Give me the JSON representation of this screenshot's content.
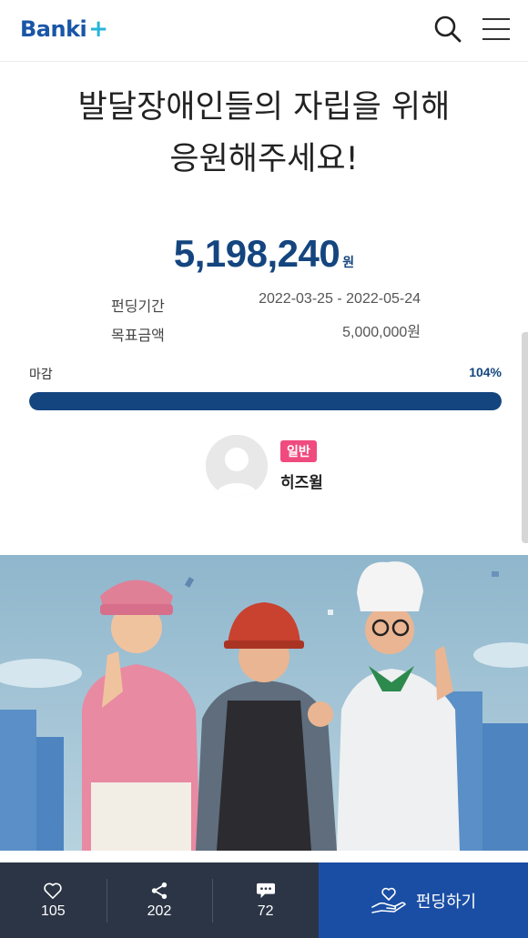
{
  "header": {
    "logo_text": "Banki",
    "logo_plus": "+",
    "search_icon": "search-icon",
    "menu_icon": "hamburger-menu-icon"
  },
  "project": {
    "title_line1": "발달장애인들의 자립을 위해",
    "title_line2": "응원해주세요!",
    "amount": "5,198,240",
    "amount_unit": "원",
    "period_label": "펀딩기간",
    "period_value": "2022-03-25 - 2022-05-24",
    "goal_label": "목표금액",
    "goal_value": "5,000,000원",
    "status_label": "마감",
    "percent_text": "104%",
    "progress_fraction": 1.0
  },
  "author": {
    "badge": "일반",
    "name": "히즈윌"
  },
  "bottom_bar": {
    "likes": "105",
    "shares": "202",
    "comments": "72",
    "fund_label": "펀딩하기"
  },
  "colors": {
    "brand": "#1a56a8",
    "accent_plus": "#27b5d8",
    "primary_dark": "#14457f",
    "badge": "#ef4b7f",
    "bar_dark": "#2b3545",
    "fund_button": "#1a4ea4"
  }
}
